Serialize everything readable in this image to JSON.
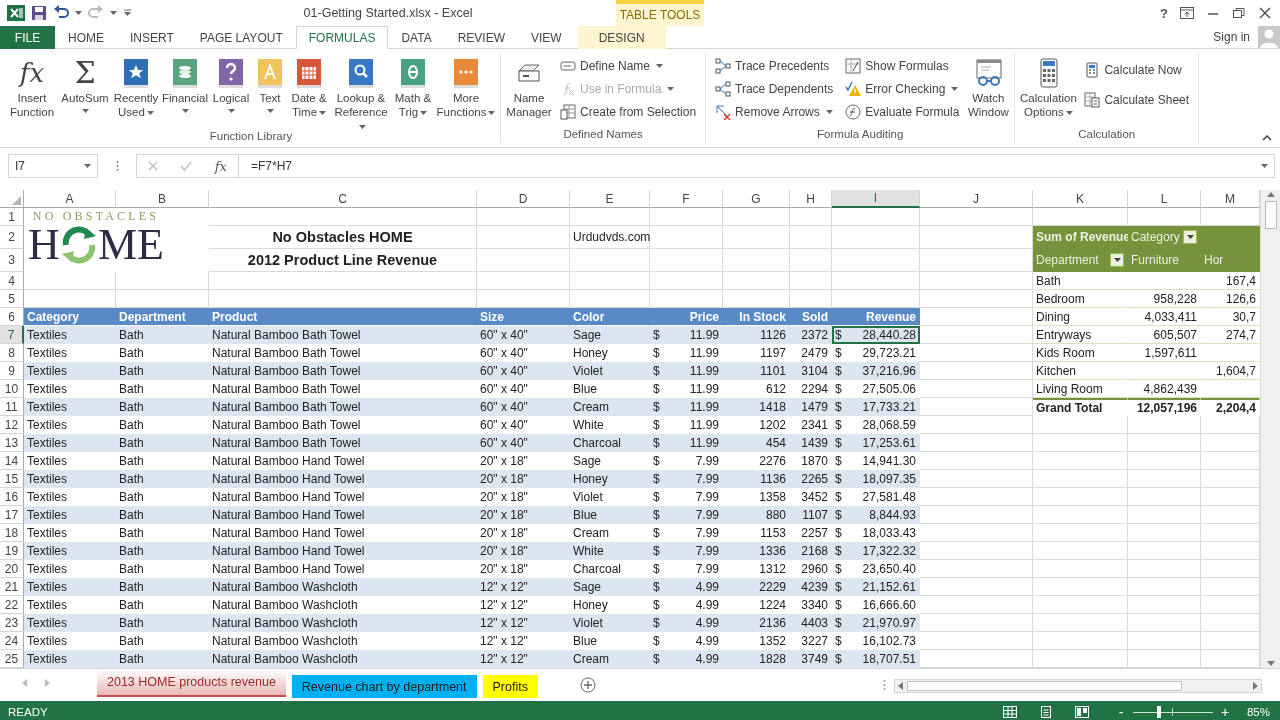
{
  "title_bar": {
    "title": "01-Getting Started.xlsx - Excel",
    "context_label": "TABLE TOOLS",
    "help": "?"
  },
  "tabs": [
    {
      "label": "FILE",
      "kind": "file",
      "selected": false
    },
    {
      "label": "HOME",
      "kind": "normal",
      "selected": false
    },
    {
      "label": "INSERT",
      "kind": "normal",
      "selected": false
    },
    {
      "label": "PAGE LAYOUT",
      "kind": "normal",
      "selected": false
    },
    {
      "label": "FORMULAS",
      "kind": "normal",
      "selected": true
    },
    {
      "label": "DATA",
      "kind": "normal",
      "selected": false
    },
    {
      "label": "REVIEW",
      "kind": "normal",
      "selected": false
    },
    {
      "label": "VIEW",
      "kind": "normal",
      "selected": false
    },
    {
      "label": "DESIGN",
      "kind": "context",
      "selected": false
    }
  ],
  "account": {
    "sign_in": "Sign in"
  },
  "ribbon": [
    {
      "title": "Function Library",
      "buttons": [
        {
          "label": "Insert Function",
          "kind": "large",
          "glyph": "fx",
          "dropdown": false,
          "disabled": false
        },
        {
          "label": "AutoSum",
          "kind": "large",
          "glyph": "Σ",
          "dropdown": true,
          "disabled": false
        },
        {
          "label": "Recently Used",
          "kind": "large",
          "dropdown": true,
          "disabled": false
        },
        {
          "label": "Financial",
          "kind": "large",
          "dropdown": true,
          "disabled": false
        },
        {
          "label": "Logical",
          "kind": "large",
          "dropdown": true,
          "disabled": false
        },
        {
          "label": "Text",
          "kind": "large",
          "dropdown": true,
          "disabled": false
        },
        {
          "label": "Date & Time",
          "kind": "large",
          "dropdown": true,
          "disabled": false
        },
        {
          "label": "Lookup & Reference",
          "kind": "large",
          "dropdown": true,
          "disabled": false
        },
        {
          "label": "Math & Trig",
          "kind": "large",
          "dropdown": true,
          "disabled": false
        },
        {
          "label": "More Functions",
          "kind": "large",
          "dropdown": true,
          "disabled": false
        }
      ]
    },
    {
      "title": "Defined Names",
      "buttons": [
        {
          "label": "Name Manager",
          "kind": "large",
          "dropdown": false,
          "disabled": false
        },
        {
          "label": "Define Name",
          "kind": "small",
          "dropdown": true,
          "disabled": false
        },
        {
          "label": "Use in Formula",
          "kind": "small",
          "dropdown": true,
          "disabled": true
        },
        {
          "label": "Create from Selection",
          "kind": "small",
          "dropdown": false,
          "disabled": false
        }
      ]
    },
    {
      "title": "Formula Auditing",
      "buttons": [
        {
          "label": "Trace Precedents",
          "kind": "small",
          "dropdown": false,
          "disabled": false
        },
        {
          "label": "Trace Dependents",
          "kind": "small",
          "dropdown": false,
          "disabled": false
        },
        {
          "label": "Remove Arrows",
          "kind": "small",
          "dropdown": true,
          "disabled": false
        },
        {
          "label": "Show Formulas",
          "kind": "small",
          "dropdown": false,
          "disabled": false
        },
        {
          "label": "Error Checking",
          "kind": "small",
          "dropdown": true,
          "disabled": false
        },
        {
          "label": "Evaluate Formula",
          "kind": "small",
          "dropdown": false,
          "disabled": false
        },
        {
          "label": "Watch Window",
          "kind": "large",
          "dropdown": false,
          "disabled": false
        }
      ]
    },
    {
      "title": "Calculation",
      "buttons": [
        {
          "label": "Calculation Options",
          "kind": "large",
          "dropdown": true,
          "disabled": false
        },
        {
          "label": "Calculate Now",
          "kind": "small",
          "dropdown": false,
          "disabled": false
        },
        {
          "label": "Calculate Sheet",
          "kind": "small",
          "dropdown": false,
          "disabled": false
        }
      ]
    }
  ],
  "formula_bar": {
    "name_box": "I7",
    "fx": "fx",
    "formula": "=F7*H7"
  },
  "sheet": {
    "columns": [
      {
        "label": "A",
        "selected": false
      },
      {
        "label": "B",
        "selected": false
      },
      {
        "label": "C",
        "selected": false
      },
      {
        "label": "D",
        "selected": false
      },
      {
        "label": "E",
        "selected": false
      },
      {
        "label": "F",
        "selected": false
      },
      {
        "label": "G",
        "selected": false
      },
      {
        "label": "H",
        "selected": false
      },
      {
        "label": "I",
        "selected": true
      },
      {
        "label": "J",
        "selected": false
      },
      {
        "label": "K",
        "selected": false
      },
      {
        "label": "L",
        "selected": false
      },
      {
        "label": "M",
        "selected": false
      }
    ],
    "rows": [
      {
        "label": "1",
        "selected": false
      },
      {
        "label": "2",
        "selected": false
      },
      {
        "label": "3",
        "selected": false
      },
      {
        "label": "4",
        "selected": false
      },
      {
        "label": "5",
        "selected": false
      },
      {
        "label": "6",
        "selected": false
      },
      {
        "label": "7",
        "selected": true
      },
      {
        "label": "8",
        "selected": false
      },
      {
        "label": "9",
        "selected": false
      },
      {
        "label": "10",
        "selected": false
      },
      {
        "label": "11",
        "selected": false
      },
      {
        "label": "12",
        "selected": false
      },
      {
        "label": "13",
        "selected": false
      },
      {
        "label": "14",
        "selected": false
      },
      {
        "label": "15",
        "selected": false
      },
      {
        "label": "16",
        "selected": false
      },
      {
        "label": "17",
        "selected": false
      },
      {
        "label": "18",
        "selected": false
      },
      {
        "label": "19",
        "selected": false
      },
      {
        "label": "20",
        "selected": false
      },
      {
        "label": "21",
        "selected": false
      },
      {
        "label": "22",
        "selected": false
      },
      {
        "label": "23",
        "selected": false
      },
      {
        "label": "24",
        "selected": false
      },
      {
        "label": "25",
        "selected": false
      }
    ],
    "logo": {
      "tagline": "NO OBSTACLES",
      "left": "H",
      "right": "ME"
    },
    "titles": [
      "No Obstacles HOME",
      "2012 Product Line Revenue"
    ],
    "note": "Urdudvds.com",
    "table": {
      "columns": [
        "Category",
        "Department",
        "Product",
        "Size",
        "Color",
        "",
        "Price",
        "In Stock",
        "Sold",
        "",
        "Revenue"
      ],
      "rows": [
        [
          "Textiles",
          "Bath",
          "Natural Bamboo Bath Towel",
          "60\" x 40\"",
          "Sage",
          "$",
          "11.99",
          "1126",
          "2372",
          "$",
          "28,440.28"
        ],
        [
          "Textiles",
          "Bath",
          "Natural Bamboo Bath Towel",
          "60\" x 40\"",
          "Honey",
          "$",
          "11.99",
          "1197",
          "2479",
          "$",
          "29,723.21"
        ],
        [
          "Textiles",
          "Bath",
          "Natural Bamboo Bath Towel",
          "60\" x 40\"",
          "Violet",
          "$",
          "11.99",
          "1101",
          "3104",
          "$",
          "37,216.96"
        ],
        [
          "Textiles",
          "Bath",
          "Natural Bamboo Bath Towel",
          "60\" x 40\"",
          "Blue",
          "$",
          "11.99",
          "612",
          "2294",
          "$",
          "27,505.06"
        ],
        [
          "Textiles",
          "Bath",
          "Natural Bamboo Bath Towel",
          "60\" x 40\"",
          "Cream",
          "$",
          "11.99",
          "1418",
          "1479",
          "$",
          "17,733.21"
        ],
        [
          "Textiles",
          "Bath",
          "Natural Bamboo Bath Towel",
          "60\" x 40\"",
          "White",
          "$",
          "11.99",
          "1202",
          "2341",
          "$",
          "28,068.59"
        ],
        [
          "Textiles",
          "Bath",
          "Natural Bamboo Bath Towel",
          "60\" x 40\"",
          "Charcoal",
          "$",
          "11.99",
          "454",
          "1439",
          "$",
          "17,253.61"
        ],
        [
          "Textiles",
          "Bath",
          "Natural Bamboo Hand Towel",
          "20\" x 18\"",
          "Sage",
          "$",
          "7.99",
          "2276",
          "1870",
          "$",
          "14,941.30"
        ],
        [
          "Textiles",
          "Bath",
          "Natural Bamboo Hand Towel",
          "20\" x 18\"",
          "Honey",
          "$",
          "7.99",
          "1136",
          "2265",
          "$",
          "18,097.35"
        ],
        [
          "Textiles",
          "Bath",
          "Natural Bamboo Hand Towel",
          "20\" x 18\"",
          "Violet",
          "$",
          "7.99",
          "1358",
          "3452",
          "$",
          "27,581.48"
        ],
        [
          "Textiles",
          "Bath",
          "Natural Bamboo Hand Towel",
          "20\" x 18\"",
          "Blue",
          "$",
          "7.99",
          "880",
          "1107",
          "$",
          "8,844.93"
        ],
        [
          "Textiles",
          "Bath",
          "Natural Bamboo Hand Towel",
          "20\" x 18\"",
          "Cream",
          "$",
          "7.99",
          "1153",
          "2257",
          "$",
          "18,033.43"
        ],
        [
          "Textiles",
          "Bath",
          "Natural Bamboo Hand Towel",
          "20\" x 18\"",
          "White",
          "$",
          "7.99",
          "1336",
          "2168",
          "$",
          "17,322.32"
        ],
        [
          "Textiles",
          "Bath",
          "Natural Bamboo Hand Towel",
          "20\" x 18\"",
          "Charcoal",
          "$",
          "7.99",
          "1312",
          "2960",
          "$",
          "23,650.40"
        ],
        [
          "Textiles",
          "Bath",
          "Natural Bamboo Washcloth",
          "12\" x 12\"",
          "Sage",
          "$",
          "4.99",
          "2229",
          "4239",
          "$",
          "21,152.61"
        ],
        [
          "Textiles",
          "Bath",
          "Natural Bamboo Washcloth",
          "12\" x 12\"",
          "Honey",
          "$",
          "4.99",
          "1224",
          "3340",
          "$",
          "16,666.60"
        ],
        [
          "Textiles",
          "Bath",
          "Natural Bamboo Washcloth",
          "12\" x 12\"",
          "Violet",
          "$",
          "4.99",
          "2136",
          "4403",
          "$",
          "21,970.97"
        ],
        [
          "Textiles",
          "Bath",
          "Natural Bamboo Washcloth",
          "12\" x 12\"",
          "Blue",
          "$",
          "4.99",
          "1352",
          "3227",
          "$",
          "16,102.73"
        ],
        [
          "Textiles",
          "Bath",
          "Natural Bamboo Washcloth",
          "12\" x 12\"",
          "Cream",
          "$",
          "4.99",
          "1828",
          "3749",
          "$",
          "18,707.51"
        ]
      ]
    },
    "pivot": {
      "value_label": "Sum of Revenue",
      "column_field": "Category",
      "row_field": "Department",
      "column_items": [
        "Furniture",
        "Hor"
      ],
      "rows": [
        {
          "label": "Bath",
          "column_2": "167,4"
        },
        {
          "label": "Bedroom",
          "furniture": "958,228",
          "column_2": "126,6"
        },
        {
          "label": "Dining",
          "furniture": "4,033,411",
          "column_2": "30,7"
        },
        {
          "label": "Entryways",
          "furniture": "605,507",
          "column_2": "274,7"
        },
        {
          "label": "Kids Room",
          "furniture": "1,597,611"
        },
        {
          "label": "Kitchen",
          "column_2": "1,604,7"
        },
        {
          "label": "Living Room",
          "furniture": "4,862,439"
        }
      ],
      "total": {
        "label": "Grand Total",
        "furniture": "12,057,196",
        "column_2": "2,204,4"
      }
    }
  },
  "sheet_tabs": [
    {
      "label": "2013 HOME products revenue",
      "selected": true,
      "color": "#e6b9b8"
    },
    {
      "label": "Revenue chart by department",
      "selected": false,
      "color": "#00b0f0"
    },
    {
      "label": "Profits",
      "selected": false,
      "color": "#ffff00"
    }
  ],
  "status_bar": {
    "status": "READY",
    "zoom_out": "-",
    "zoom_in": "+",
    "zoom": "85%",
    "zoom_slider": {
      "level": 0.32
    }
  }
}
